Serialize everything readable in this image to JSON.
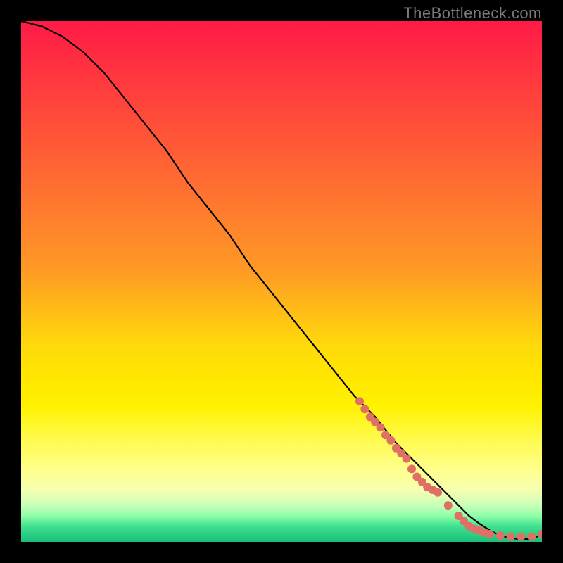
{
  "attribution": "TheBottleneck.com",
  "chart_data": {
    "type": "line",
    "title": "",
    "xlabel": "",
    "ylabel": "",
    "xlim": [
      0,
      100
    ],
    "ylim": [
      0,
      100
    ],
    "series": [
      {
        "name": "curve",
        "style": "line",
        "x": [
          0,
          4,
          8,
          12,
          16,
          20,
          24,
          28,
          32,
          36,
          40,
          44,
          48,
          52,
          56,
          60,
          64,
          68,
          72,
          76,
          80,
          82,
          84,
          86,
          88,
          90,
          92,
          94,
          96,
          98,
          100
        ],
        "values": [
          100,
          99,
          97,
          94,
          90,
          85,
          80,
          75,
          69,
          64,
          59,
          53,
          48,
          43,
          38,
          33,
          28,
          24,
          19,
          15,
          11,
          9,
          7,
          5,
          3.5,
          2.2,
          1.2,
          0.7,
          0.5,
          0.6,
          1.4
        ]
      },
      {
        "name": "highlight-points",
        "style": "scatter",
        "x": [
          65,
          66,
          67,
          68,
          69,
          70,
          71,
          72,
          73,
          74,
          75,
          76,
          77,
          78,
          79,
          80,
          82,
          84,
          85,
          86,
          87,
          88,
          89,
          90,
          92,
          94,
          96,
          98,
          100
        ],
        "values": [
          27,
          25.5,
          24,
          23,
          22,
          20.5,
          19.5,
          18,
          17,
          16,
          14,
          12.5,
          11.5,
          10.5,
          10,
          9.5,
          7,
          5,
          4,
          3,
          2.5,
          2.2,
          1.8,
          1.5,
          1.2,
          1.0,
          1.0,
          1.0,
          1.5
        ]
      }
    ],
    "colors": {
      "curve": "#000000",
      "points": "#e07066"
    }
  }
}
